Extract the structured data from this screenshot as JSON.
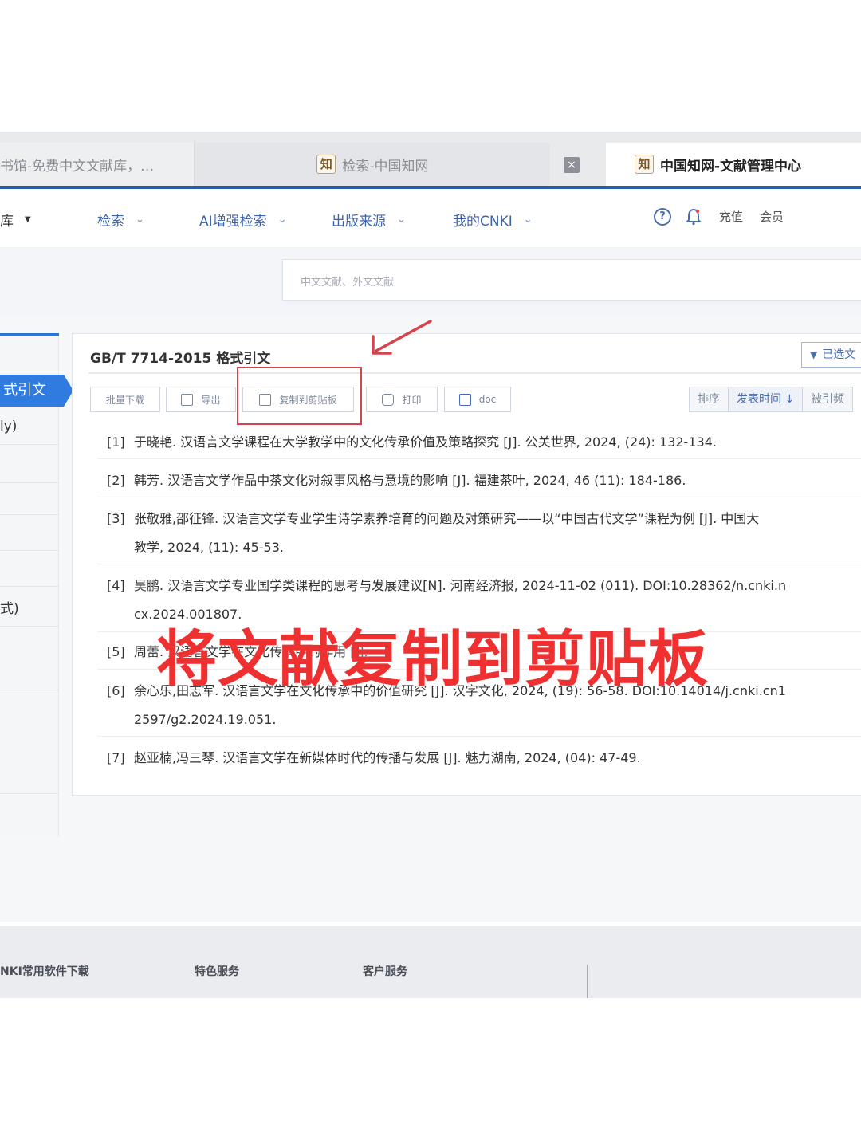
{
  "tabs": [
    {
      "label": "书馆-免费中文文献库，…"
    },
    {
      "label": "检索-中国知网"
    },
    {
      "label": "中国知网-文献管理中心"
    }
  ],
  "tab_icon_char": "知",
  "tab_close_glyph": "×",
  "nav": {
    "left_cut": "库",
    "items": [
      {
        "label": "检索"
      },
      {
        "label": "AI增强检索"
      },
      {
        "label": "出版来源"
      },
      {
        "label": "我的CNKI"
      }
    ],
    "recharge": "充值",
    "member": "会员"
  },
  "search": {
    "placeholder": "中文文献、外文文献"
  },
  "sidebar": {
    "active": "式引文",
    "items": [
      "ly)",
      "式)"
    ]
  },
  "panel": {
    "title": "GB/T 7714-2015 格式引文",
    "filter": "已选文",
    "toolbar": {
      "batch_download": "批量下载",
      "export": "导出",
      "copy_clipboard": "复制到剪贴板",
      "print": "打印",
      "doc": "doc"
    },
    "sort": {
      "label": "排序",
      "publish_time": "发表时间",
      "cited": "被引频"
    }
  },
  "references": [
    {
      "num": "[1]",
      "text": "于晓艳. 汉语言文学课程在大学教学中的文化传承价值及策略探究 [J]. 公关世界, 2024, (24): 132-134."
    },
    {
      "num": "[2]",
      "text": "韩芳. 汉语言文学作品中茶文化对叙事风格与意境的影响 [J]. 福建茶叶, 2024, 46 (11): 184-186."
    },
    {
      "num": "[3]",
      "text": "张敬雅,邵征锋. 汉语言文学专业学生诗学素养培育的问题及对策研究——以“中国古代文学”课程为例 [J]. 中国大",
      "cont": "教学, 2024, (11): 45-53."
    },
    {
      "num": "[4]",
      "text": "吴鹏. 汉语言文学专业国学类课程的思考与发展建议[N]. 河南经济报, 2024-11-02 (011). DOI:10.28362/n.cnki.n",
      "cont": "cx.2024.001807."
    },
    {
      "num": "[5]",
      "text": "周蕾. 汉语言文学在文化传承中的作用 [J]."
    },
    {
      "num": "[6]",
      "text": "余心乐,田志军. 汉语言文学在文化传承中的价值研究 [J]. 汉字文化, 2024, (19): 56-58. DOI:10.14014/j.cnki.cn1",
      "cont": "2597/g2.2024.19.051."
    },
    {
      "num": "[7]",
      "text": "赵亚楠,冯三琴. 汉语言文学在新媒体时代的传播与发展 [J]. 魅力湖南, 2024, (04): 47-49."
    }
  ],
  "overlay_caption": "将文献复制到剪贴板",
  "footer": {
    "items": [
      "NKI常用软件下载",
      "特色服务",
      "客户服务"
    ]
  },
  "colors": {
    "accent": "#2f7be0",
    "highlight": "#d4444a",
    "caption": "#ef3030"
  }
}
